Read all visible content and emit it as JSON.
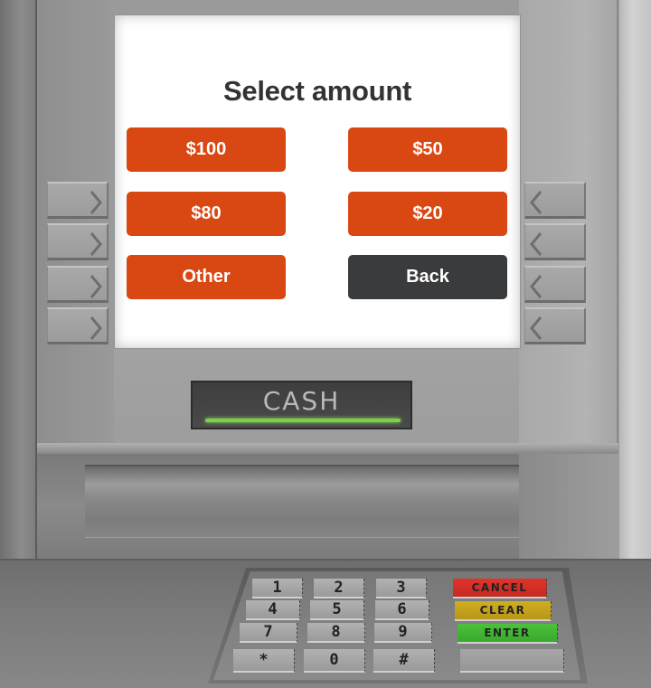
{
  "screen": {
    "title": "Select amount",
    "buttons": [
      {
        "label": "$100",
        "style": "primary"
      },
      {
        "label": "$50",
        "style": "primary"
      },
      {
        "label": "$80",
        "style": "primary"
      },
      {
        "label": "$20",
        "style": "primary"
      },
      {
        "label": "Other",
        "style": "primary"
      },
      {
        "label": "Back",
        "style": "secondary"
      }
    ]
  },
  "side_keys": {
    "left": [
      "chevron-right-icon",
      "chevron-right-icon",
      "chevron-right-icon",
      "chevron-right-icon"
    ],
    "right": [
      "chevron-left-icon",
      "chevron-left-icon",
      "chevron-left-icon",
      "chevron-left-icon"
    ]
  },
  "cash_slot": {
    "label": "CASH",
    "indicator_status": "active"
  },
  "keypad": {
    "digits": [
      "1",
      "2",
      "3",
      "4",
      "5",
      "6",
      "7",
      "8",
      "9",
      "*",
      "0",
      "#"
    ],
    "function_keys": [
      "CANCEL",
      "CLEAR",
      "ENTER",
      ""
    ]
  },
  "colors": {
    "primary": "#d94712",
    "secondary": "#3a3b3d",
    "title": "#333333",
    "cash_light": "#7ed04a",
    "cancel": "#e0342a",
    "clear": "#cfae20",
    "enter": "#4cc23c"
  }
}
